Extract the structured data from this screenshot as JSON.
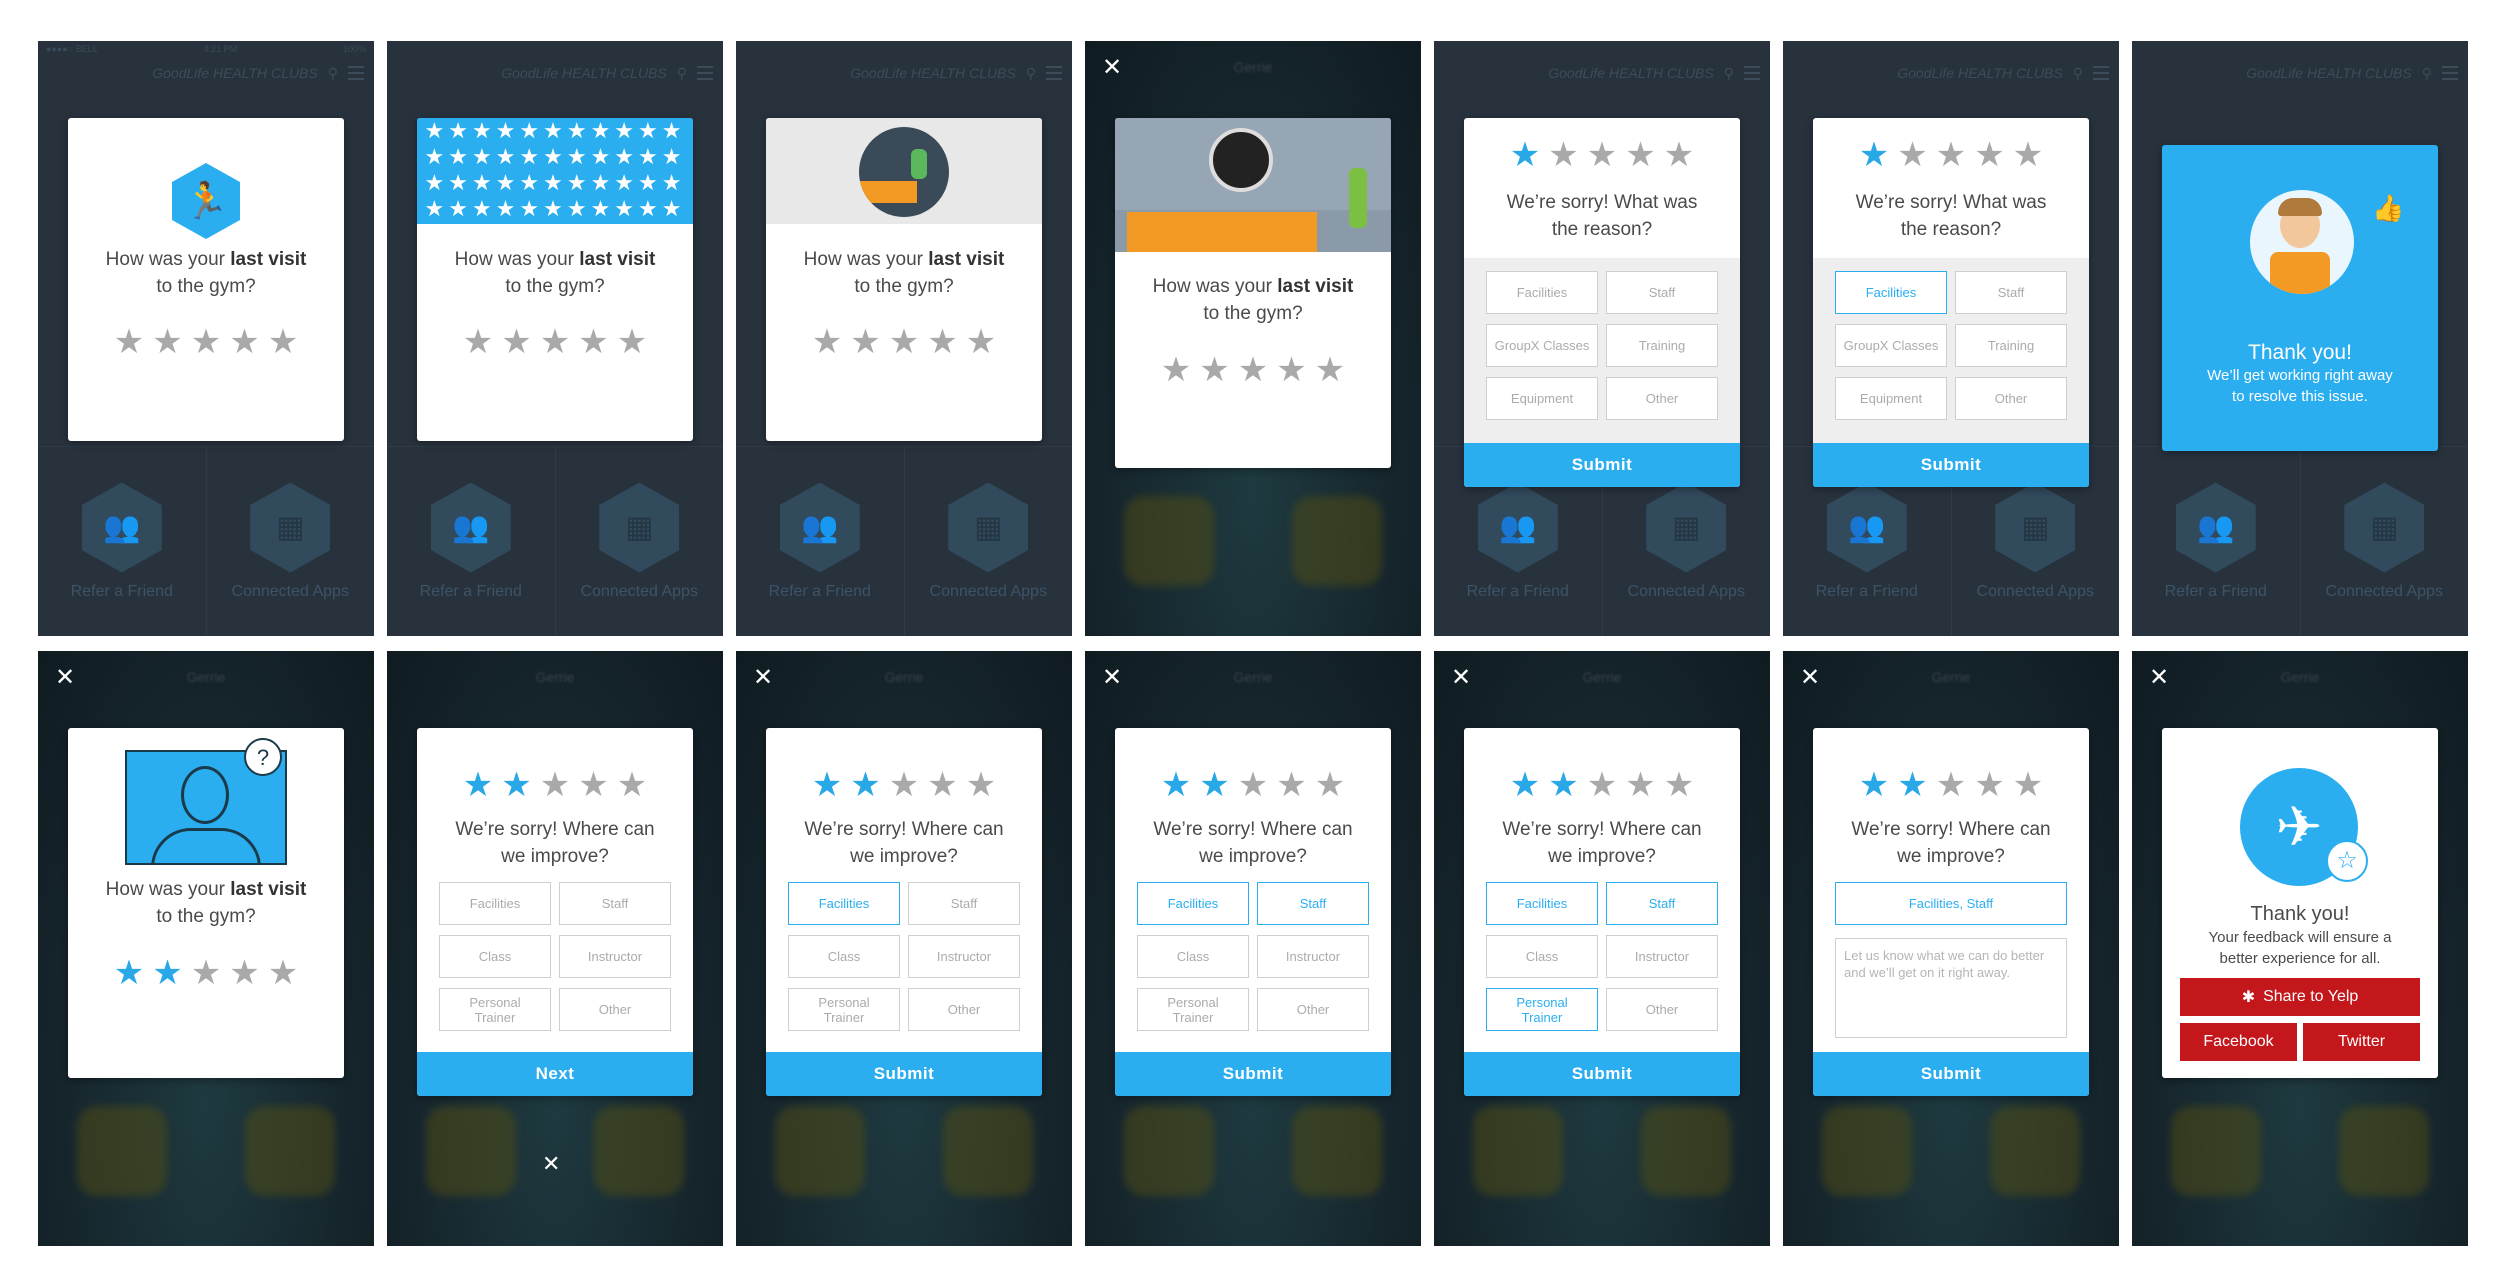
{
  "status_bar": {
    "carrier": "●●●●○ BELL",
    "time": "4:21 PM",
    "battery": "100%"
  },
  "app": {
    "brand": "GoodLife HEALTH CLUBS",
    "blur_title": "Gerrie"
  },
  "tiles": [
    {
      "label": "Refer a Friend",
      "icon": "refer-friend-icon"
    },
    {
      "label": "Connected Apps",
      "icon": "connected-apps-icon"
    }
  ],
  "rating": {
    "question_pre": "How was your",
    "question_bold": "last visit",
    "question_post": "to the gym?"
  },
  "reason": {
    "question": "We’re sorry! What was the reason?",
    "options": [
      "Facilities",
      "Staff",
      "GroupX Classes",
      "Training",
      "Equipment",
      "Other"
    ],
    "submit_label": "Submit"
  },
  "improve": {
    "question": "We’re sorry! Where can we improve?",
    "options": [
      "Facilities",
      "Staff",
      "Class",
      "Instructor",
      "Personal Trainer",
      "Other"
    ],
    "next_label": "Next",
    "submit_label": "Submit",
    "selected_summary": "Facilities, Staff",
    "textarea_placeholder": "Let us know what we can do better and we’ll get on it right away."
  },
  "thanks_blue": {
    "title": "Thank you!",
    "line1": "We’ll get working right away",
    "line2": "to resolve this issue."
  },
  "thanks_share": {
    "title": "Thank you!",
    "line1": "Your feedback will ensure a",
    "line2": "better experience for all.",
    "yelp_label": "Share to Yelp",
    "facebook_label": "Facebook",
    "twitter_label": "Twitter"
  },
  "ratings": {
    "s1": 0,
    "s2": 0,
    "s3": 0,
    "s4": 0,
    "s5": 1,
    "s6": 1,
    "s8": 2,
    "s9": 2,
    "s10": 2,
    "s11": 2,
    "s12": 2,
    "s13": 2
  },
  "colors": {
    "accent": "#2baef0",
    "app_bg": "#28323d",
    "yelp_red": "#c4171c"
  }
}
